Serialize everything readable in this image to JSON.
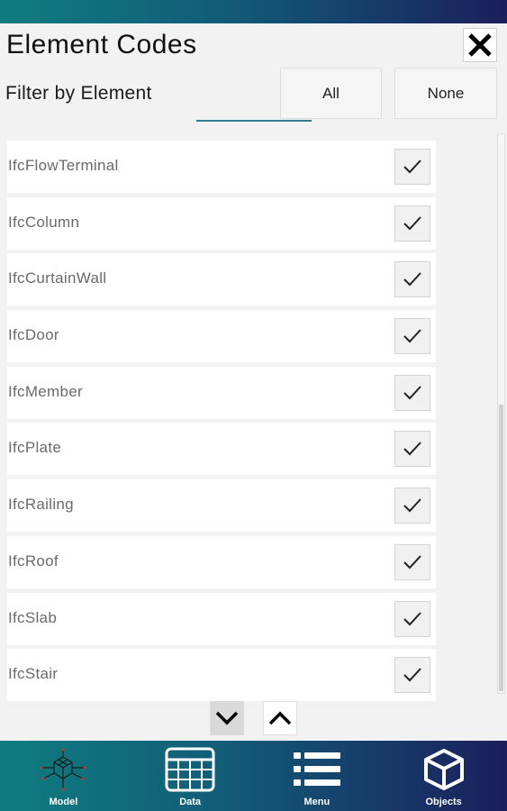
{
  "header": {
    "title": "Element Codes",
    "close_icon": "close-icon"
  },
  "filter": {
    "label": "Filter by Element",
    "all_label": "All",
    "none_label": "None"
  },
  "elements": [
    {
      "name": "IfcFlowTerminal",
      "checked": true
    },
    {
      "name": "IfcColumn",
      "checked": true
    },
    {
      "name": "IfcCurtainWall",
      "checked": true
    },
    {
      "name": "IfcDoor",
      "checked": true
    },
    {
      "name": "IfcMember",
      "checked": true
    },
    {
      "name": "IfcPlate",
      "checked": true
    },
    {
      "name": "IfcRailing",
      "checked": true
    },
    {
      "name": "IfcRoof",
      "checked": true
    },
    {
      "name": "IfcSlab",
      "checked": true
    },
    {
      "name": "IfcStair",
      "checked": true
    }
  ],
  "pager": {
    "down_icon": "chevron-down-icon",
    "up_icon": "chevron-up-icon"
  },
  "navbar": {
    "items": [
      {
        "label": "Model",
        "icon": "model-icon"
      },
      {
        "label": "Data",
        "icon": "table-icon"
      },
      {
        "label": "Menu",
        "icon": "list-icon"
      },
      {
        "label": "Objects",
        "icon": "cube-icon"
      }
    ]
  },
  "colors": {
    "gradient_start": "#0f7d80",
    "gradient_end": "#1b1f5c",
    "tab_underline": "#2b7f95"
  }
}
